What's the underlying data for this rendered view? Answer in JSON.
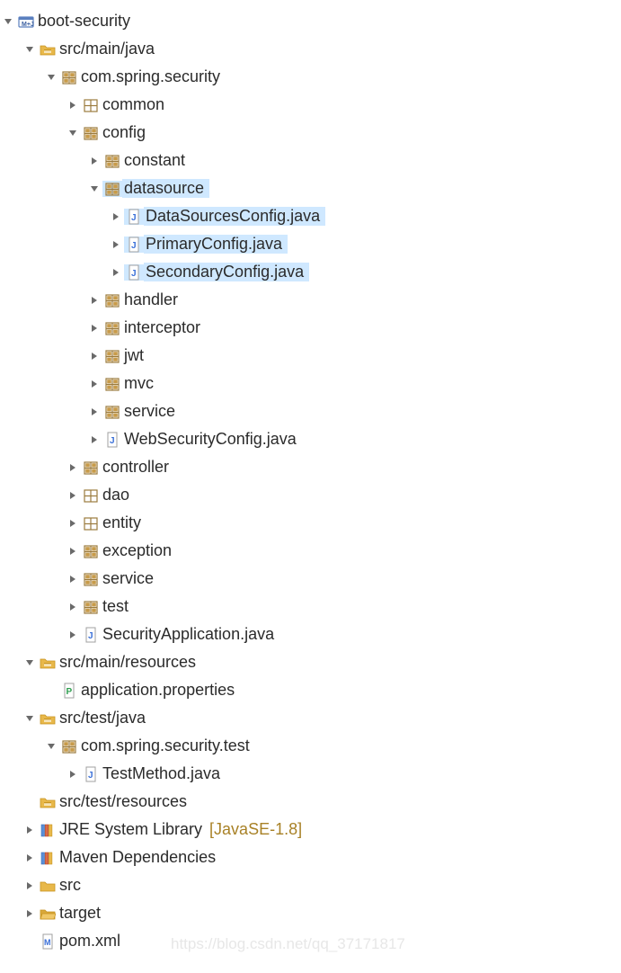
{
  "watermark": "https://blog.csdn.net/qq_37171817",
  "tree": [
    {
      "depth": 0,
      "tw": "down",
      "icon": "project",
      "label": "boot-security",
      "name": "project-root",
      "sel": false
    },
    {
      "depth": 1,
      "tw": "down",
      "icon": "srcfolder",
      "label": "src/main/java",
      "name": "src-main-java",
      "sel": false
    },
    {
      "depth": 2,
      "tw": "down",
      "icon": "package",
      "label": "com.spring.security",
      "name": "pkg-com-spring-security",
      "sel": false
    },
    {
      "depth": 3,
      "tw": "right",
      "icon": "package-empty",
      "label": "common",
      "name": "pkg-common",
      "sel": false
    },
    {
      "depth": 3,
      "tw": "down",
      "icon": "package",
      "label": "config",
      "name": "pkg-config",
      "sel": false
    },
    {
      "depth": 4,
      "tw": "right",
      "icon": "package",
      "label": "constant",
      "name": "pkg-constant",
      "sel": false
    },
    {
      "depth": 4,
      "tw": "down",
      "icon": "package",
      "label": "datasource",
      "name": "pkg-datasource",
      "sel": true
    },
    {
      "depth": 5,
      "tw": "right",
      "icon": "java",
      "label": "DataSourcesConfig.java",
      "name": "file-datasourcesconfig",
      "sel": true
    },
    {
      "depth": 5,
      "tw": "right",
      "icon": "java",
      "label": "PrimaryConfig.java",
      "name": "file-primaryconfig",
      "sel": true
    },
    {
      "depth": 5,
      "tw": "right",
      "icon": "java",
      "label": "SecondaryConfig.java",
      "name": "file-secondaryconfig",
      "sel": true
    },
    {
      "depth": 4,
      "tw": "right",
      "icon": "package",
      "label": "handler",
      "name": "pkg-handler",
      "sel": false
    },
    {
      "depth": 4,
      "tw": "right",
      "icon": "package",
      "label": "interceptor",
      "name": "pkg-interceptor",
      "sel": false
    },
    {
      "depth": 4,
      "tw": "right",
      "icon": "package",
      "label": "jwt",
      "name": "pkg-jwt",
      "sel": false
    },
    {
      "depth": 4,
      "tw": "right",
      "icon": "package",
      "label": "mvc",
      "name": "pkg-mvc",
      "sel": false
    },
    {
      "depth": 4,
      "tw": "right",
      "icon": "package",
      "label": "service",
      "name": "pkg-config-service",
      "sel": false
    },
    {
      "depth": 4,
      "tw": "right",
      "icon": "java",
      "label": "WebSecurityConfig.java",
      "name": "file-websecurityconfig",
      "sel": false
    },
    {
      "depth": 3,
      "tw": "right",
      "icon": "package",
      "label": "controller",
      "name": "pkg-controller",
      "sel": false
    },
    {
      "depth": 3,
      "tw": "right",
      "icon": "package-empty",
      "label": "dao",
      "name": "pkg-dao",
      "sel": false
    },
    {
      "depth": 3,
      "tw": "right",
      "icon": "package-empty",
      "label": "entity",
      "name": "pkg-entity",
      "sel": false
    },
    {
      "depth": 3,
      "tw": "right",
      "icon": "package",
      "label": "exception",
      "name": "pkg-exception",
      "sel": false
    },
    {
      "depth": 3,
      "tw": "right",
      "icon": "package",
      "label": "service",
      "name": "pkg-service",
      "sel": false
    },
    {
      "depth": 3,
      "tw": "right",
      "icon": "package",
      "label": "test",
      "name": "pkg-test",
      "sel": false
    },
    {
      "depth": 3,
      "tw": "right",
      "icon": "java",
      "label": "SecurityApplication.java",
      "name": "file-securityapplication",
      "sel": false
    },
    {
      "depth": 1,
      "tw": "down",
      "icon": "srcfolder",
      "label": "src/main/resources",
      "name": "src-main-resources",
      "sel": false
    },
    {
      "depth": 2,
      "tw": "",
      "icon": "props",
      "label": "application.properties",
      "name": "file-application-properties",
      "sel": false
    },
    {
      "depth": 1,
      "tw": "down",
      "icon": "srcfolder",
      "label": "src/test/java",
      "name": "src-test-java",
      "sel": false
    },
    {
      "depth": 2,
      "tw": "down",
      "icon": "package",
      "label": "com.spring.security.test",
      "name": "pkg-test-root",
      "sel": false
    },
    {
      "depth": 3,
      "tw": "right",
      "icon": "java",
      "label": "TestMethod.java",
      "name": "file-testmethod",
      "sel": false
    },
    {
      "depth": 1,
      "tw": "",
      "icon": "srcfolder",
      "label": "src/test/resources",
      "name": "src-test-resources",
      "sel": false
    },
    {
      "depth": 1,
      "tw": "right",
      "icon": "library",
      "label": "JRE System Library",
      "decor": "[JavaSE-1.8]",
      "name": "jre-system-library",
      "sel": false
    },
    {
      "depth": 1,
      "tw": "right",
      "icon": "library",
      "label": "Maven Dependencies",
      "name": "maven-dependencies",
      "sel": false
    },
    {
      "depth": 1,
      "tw": "right",
      "icon": "folder",
      "label": "src",
      "name": "folder-src",
      "sel": false
    },
    {
      "depth": 1,
      "tw": "right",
      "icon": "folder-open",
      "label": "target",
      "name": "folder-target",
      "sel": false
    },
    {
      "depth": 1,
      "tw": "",
      "icon": "xml",
      "label": "pom.xml",
      "name": "file-pom",
      "sel": false
    }
  ]
}
